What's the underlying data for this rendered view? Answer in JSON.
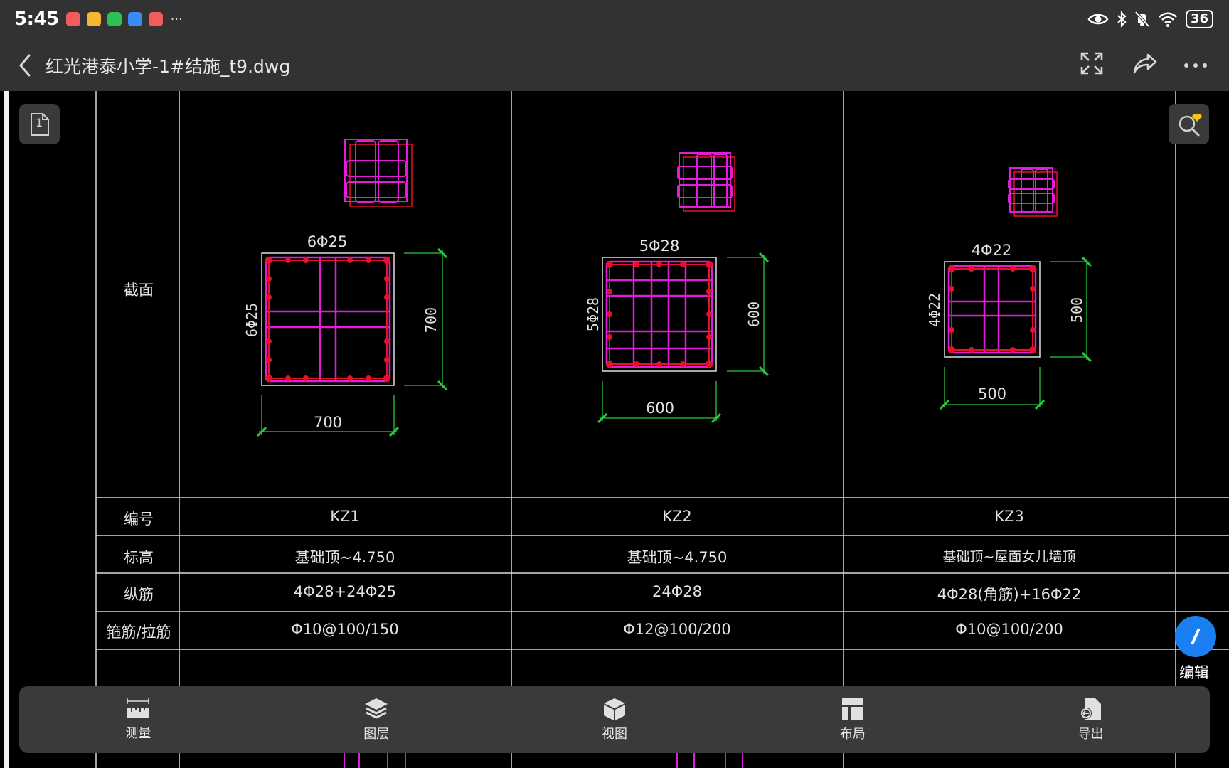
{
  "status_bar": {
    "time": "5:45",
    "more": "···",
    "battery": "36",
    "notifications": [
      {
        "icon": "app-red-icon",
        "color": "#f25c5c"
      },
      {
        "icon": "mail-icon",
        "color": "#f5b731"
      },
      {
        "icon": "wechat-icon",
        "color": "#2bc253"
      },
      {
        "icon": "shield-app-icon",
        "color": "#3a8cf5"
      },
      {
        "icon": "app-red-2-icon",
        "color": "#f25c5c"
      }
    ]
  },
  "toolbar": {
    "title": "红光港泰小学-1#结施_t9.dwg"
  },
  "drawing": {
    "row_labels": {
      "section": "截面",
      "id": "编号",
      "elevation": "标高",
      "longitudinal": "纵筋",
      "stirrup": "箍筋/拉筋"
    },
    "columns": [
      {
        "id": "KZ1",
        "elevation": "基础顶~4.750",
        "longitudinal": "4Φ28+24Φ25",
        "stirrup": "Φ10@100/150",
        "top_bars": "6Φ25",
        "side_bars": "6Φ25",
        "width": "700",
        "height": "700"
      },
      {
        "id": "KZ2",
        "elevation": "基础顶~4.750",
        "longitudinal": "24Φ28",
        "stirrup": "Φ12@100/200",
        "top_bars": "5Φ28",
        "side_bars": "5Φ28",
        "width": "600",
        "height": "600"
      },
      {
        "id": "KZ3",
        "elevation": "基础顶~屋面女儿墙顶",
        "longitudinal": "4Φ28(角筋)+16Φ22",
        "stirrup": "Φ10@100/200",
        "top_bars": "4Φ22",
        "side_bars": "4Φ22",
        "width": "500",
        "height": "500"
      }
    ]
  },
  "page_indicator": "1",
  "edit": {
    "label": "编辑"
  },
  "bottom_bar": {
    "items": [
      {
        "label": "测量",
        "icon": "ruler-icon"
      },
      {
        "label": "图层",
        "icon": "layers-icon"
      },
      {
        "label": "视图",
        "icon": "cube-icon"
      },
      {
        "label": "布局",
        "icon": "layout-icon"
      },
      {
        "label": "导出",
        "icon": "export-icon"
      }
    ]
  },
  "colors": {
    "bar_bg": "#323232",
    "button_bg": "#3a3a3a",
    "accent": "#1a7ff0",
    "stirrup": "#e41cd8",
    "rebar": "#e8102a",
    "dimension": "#27c93f"
  }
}
